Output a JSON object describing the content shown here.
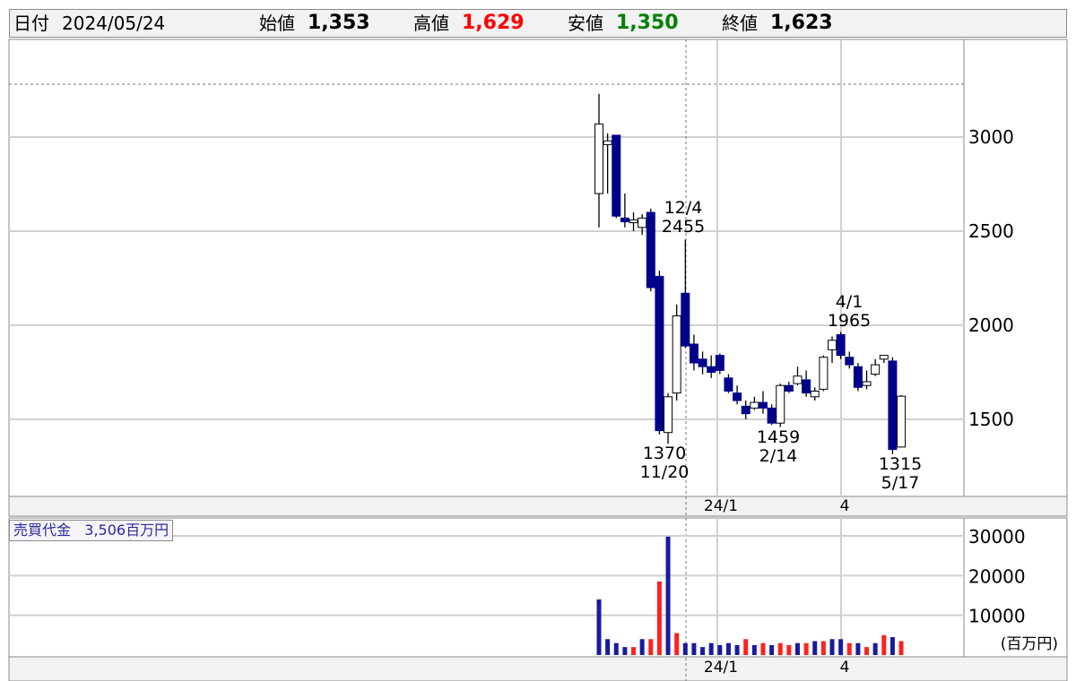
{
  "header": {
    "date_label": "日付",
    "date": "2024/05/24",
    "open_label": "始値",
    "open": "1,353",
    "high_label": "高値",
    "high": "1,629",
    "low_label": "安値",
    "low": "1,350",
    "close_label": "終値",
    "close": "1,623",
    "colors": {
      "high": "#ff0000",
      "low": "#008000"
    }
  },
  "volume_legend": {
    "label": "売買代金",
    "value": "3,506百万円"
  },
  "volume_unit": "(百万円)",
  "colors": {
    "up_body": "#ffffff",
    "down_body": "#00008b",
    "vol_up": "#ff2020",
    "vol_down": "#1a1aa0",
    "grid": "#d0d0d0"
  },
  "chart_data": [
    {
      "type": "candlestick",
      "title": "",
      "x_tick_labels": [
        "24/1",
        "4"
      ],
      "y_ticks": [
        1500,
        2000,
        2500,
        3000
      ],
      "ylim": [
        1100,
        3500
      ],
      "grid": true,
      "annotations": [
        {
          "date": "12/4",
          "value": "2455"
        },
        {
          "date": "4/1",
          "value": "1965"
        },
        {
          "value": "1370",
          "date": "11/20"
        },
        {
          "value": "1459",
          "date": "2/14"
        },
        {
          "value": "1315",
          "date": "5/17"
        }
      ],
      "candles": [
        {
          "o": 2700,
          "h": 3230,
          "l": 2520,
          "c": 3070
        },
        {
          "o": 2960,
          "h": 3020,
          "l": 2700,
          "c": 2980
        },
        {
          "o": 3010,
          "h": 3010,
          "l": 2570,
          "c": 2580
        },
        {
          "o": 2570,
          "h": 2700,
          "l": 2520,
          "c": 2550
        },
        {
          "o": 2545,
          "h": 2600,
          "l": 2500,
          "c": 2560
        },
        {
          "o": 2520,
          "h": 2590,
          "l": 2480,
          "c": 2570
        },
        {
          "o": 2600,
          "h": 2620,
          "l": 2180,
          "c": 2200
        },
        {
          "o": 2260,
          "h": 2290,
          "l": 1420,
          "c": 1440
        },
        {
          "o": 1430,
          "h": 1640,
          "l": 1370,
          "c": 1620
        },
        {
          "o": 1640,
          "h": 2110,
          "l": 1600,
          "c": 2050
        },
        {
          "o": 2170,
          "h": 2455,
          "l": 1880,
          "c": 1890
        },
        {
          "o": 1900,
          "h": 1950,
          "l": 1760,
          "c": 1800
        },
        {
          "o": 1820,
          "h": 1860,
          "l": 1740,
          "c": 1780
        },
        {
          "o": 1780,
          "h": 1840,
          "l": 1720,
          "c": 1750
        },
        {
          "o": 1840,
          "h": 1850,
          "l": 1740,
          "c": 1760
        },
        {
          "o": 1720,
          "h": 1740,
          "l": 1640,
          "c": 1650
        },
        {
          "o": 1640,
          "h": 1680,
          "l": 1580,
          "c": 1600
        },
        {
          "o": 1570,
          "h": 1600,
          "l": 1500,
          "c": 1530
        },
        {
          "o": 1560,
          "h": 1620,
          "l": 1550,
          "c": 1590
        },
        {
          "o": 1590,
          "h": 1650,
          "l": 1530,
          "c": 1560
        },
        {
          "o": 1560,
          "h": 1580,
          "l": 1470,
          "c": 1480
        },
        {
          "o": 1480,
          "h": 1690,
          "l": 1459,
          "c": 1680
        },
        {
          "o": 1680,
          "h": 1700,
          "l": 1640,
          "c": 1650
        },
        {
          "o": 1690,
          "h": 1780,
          "l": 1680,
          "c": 1730
        },
        {
          "o": 1710,
          "h": 1760,
          "l": 1620,
          "c": 1640
        },
        {
          "o": 1620,
          "h": 1670,
          "l": 1600,
          "c": 1650
        },
        {
          "o": 1660,
          "h": 1840,
          "l": 1650,
          "c": 1830
        },
        {
          "o": 1870,
          "h": 1940,
          "l": 1800,
          "c": 1920
        },
        {
          "o": 1950,
          "h": 1965,
          "l": 1820,
          "c": 1840
        },
        {
          "o": 1830,
          "h": 1860,
          "l": 1770,
          "c": 1790
        },
        {
          "o": 1780,
          "h": 1800,
          "l": 1650,
          "c": 1670
        },
        {
          "o": 1680,
          "h": 1760,
          "l": 1660,
          "c": 1700
        },
        {
          "o": 1740,
          "h": 1820,
          "l": 1730,
          "c": 1790
        },
        {
          "o": 1820,
          "h": 1840,
          "l": 1800,
          "c": 1840
        },
        {
          "o": 1810,
          "h": 1830,
          "l": 1315,
          "c": 1340
        },
        {
          "o": 1353,
          "h": 1629,
          "l": 1350,
          "c": 1623
        }
      ]
    },
    {
      "type": "bar",
      "title": "売買代金",
      "ylabel": "(百万円)",
      "y_ticks": [
        10000,
        20000,
        30000
      ],
      "ylim": [
        0,
        36000
      ],
      "values": [
        14000,
        4000,
        3000,
        2000,
        2000,
        4000,
        4000,
        18500,
        29800,
        5500,
        3000,
        3000,
        2000,
        3000,
        2500,
        3000,
        2500,
        4000,
        2500,
        3000,
        2500,
        3000,
        2500,
        3000,
        3000,
        3500,
        3500,
        4000,
        4000,
        3000,
        3000,
        2000,
        3000,
        5000,
        4500,
        3500
      ],
      "directions": [
        "down",
        "down",
        "down",
        "down",
        "up",
        "down",
        "up",
        "up",
        "down",
        "up",
        "down",
        "down",
        "down",
        "down",
        "down",
        "down",
        "down",
        "up",
        "down",
        "up",
        "down",
        "up",
        "up",
        "down",
        "up",
        "down",
        "up",
        "down",
        "down",
        "up",
        "down",
        "up",
        "down",
        "up",
        "down",
        "up"
      ]
    }
  ]
}
